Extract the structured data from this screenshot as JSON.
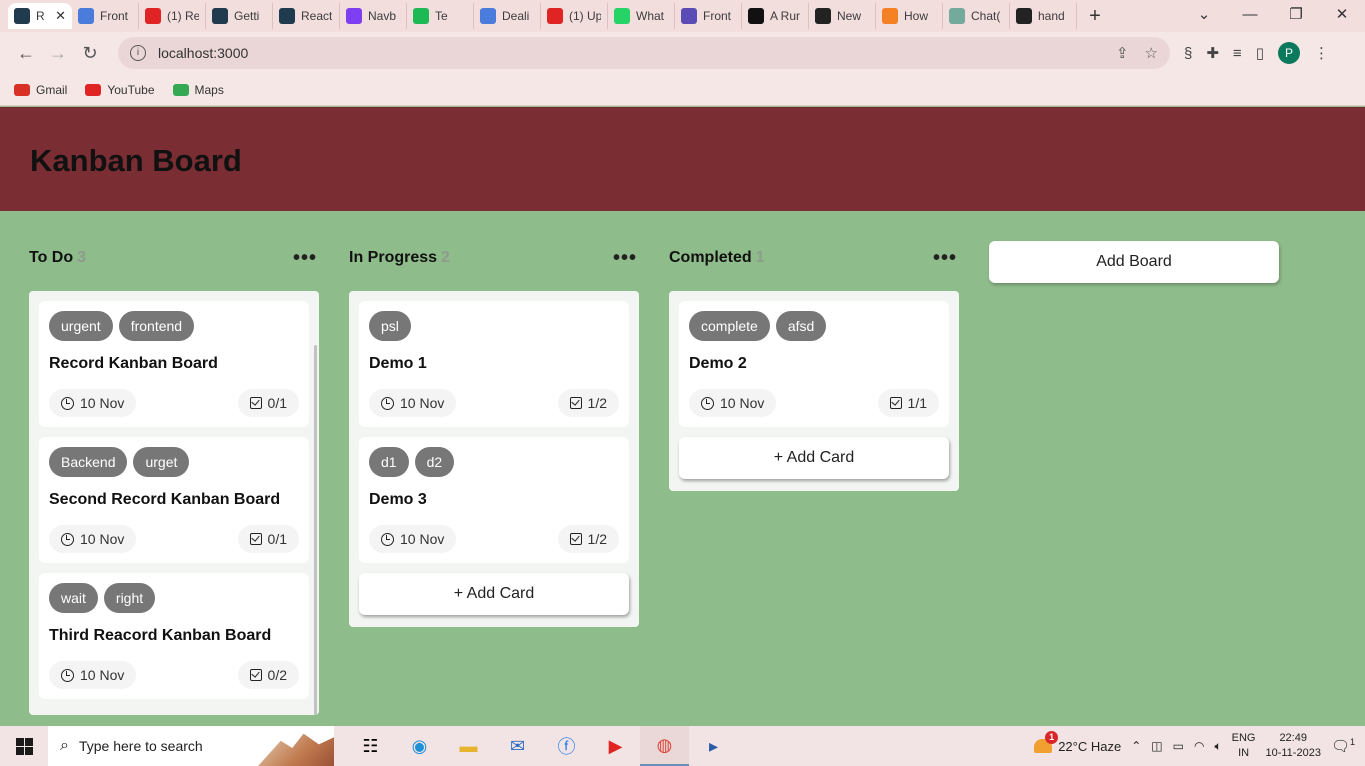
{
  "browser": {
    "tabs": [
      {
        "label": "R",
        "color": "#1f3b4d",
        "active": true
      },
      {
        "label": "Front",
        "color": "#4a7cdb"
      },
      {
        "label": "(1) Re",
        "color": "#e02424"
      },
      {
        "label": "Getti",
        "color": "#1f3b4d"
      },
      {
        "label": "React",
        "color": "#1f3b4d"
      },
      {
        "label": "Navb",
        "color": "#7e3ff2"
      },
      {
        "label": "Te",
        "color": "#1db954"
      },
      {
        "label": "Deali",
        "color": "#4a7cdb"
      },
      {
        "label": "(1) Up",
        "color": "#e02424"
      },
      {
        "label": "What",
        "color": "#25d366"
      },
      {
        "label": "Front",
        "color": "#5b4bb7"
      },
      {
        "label": "A Rur",
        "color": "#111111"
      },
      {
        "label": "New",
        "color": "#222222"
      },
      {
        "label": "How",
        "color": "#f48024"
      },
      {
        "label": "Chat(",
        "color": "#74aa9c"
      },
      {
        "label": "hand",
        "color": "#222222"
      }
    ],
    "new_tab": "+",
    "url": "localhost:3000",
    "bookmarks": [
      {
        "label": "Gmail",
        "color": "#d93025"
      },
      {
        "label": "YouTube",
        "color": "#e02424"
      },
      {
        "label": "Maps",
        "color": "#34a853"
      }
    ],
    "profile_initial": "P"
  },
  "app": {
    "title": "Kanban Board",
    "add_board_label": "Add Board",
    "add_card_label": "+ Add Card",
    "boards": [
      {
        "title": "To Do",
        "count": "3",
        "cards": [
          {
            "labels": [
              "urgent",
              "frontend"
            ],
            "title": "Record Kanban Board",
            "date": "10 Nov",
            "tasks": "0/1"
          },
          {
            "labels": [
              "Backend",
              "urget"
            ],
            "title": "Second Record Kanban Board",
            "date": "10 Nov",
            "tasks": "0/1"
          },
          {
            "labels": [
              "wait",
              "right"
            ],
            "title": "Third Reacord Kanban Board",
            "date": "10 Nov",
            "tasks": "0/2"
          }
        ]
      },
      {
        "title": "In Progress",
        "count": "2",
        "cards": [
          {
            "labels": [
              "psl"
            ],
            "title": "Demo 1",
            "date": "10 Nov",
            "tasks": "1/2"
          },
          {
            "labels": [
              "d1",
              "d2"
            ],
            "title": "Demo 3",
            "date": "10 Nov",
            "tasks": "1/2"
          }
        ]
      },
      {
        "title": "Completed",
        "count": "1",
        "cards": [
          {
            "labels": [
              "complete",
              "afsd"
            ],
            "title": "Demo 2",
            "date": "10 Nov",
            "tasks": "1/1"
          }
        ]
      }
    ]
  },
  "taskbar": {
    "search_placeholder": "Type here to search",
    "weather": "22°C  Haze",
    "weather_badge": "1",
    "lang_line1": "ENG",
    "lang_line2": "IN",
    "time": "22:49",
    "date": "10-11-2023",
    "notification_count": "1"
  }
}
